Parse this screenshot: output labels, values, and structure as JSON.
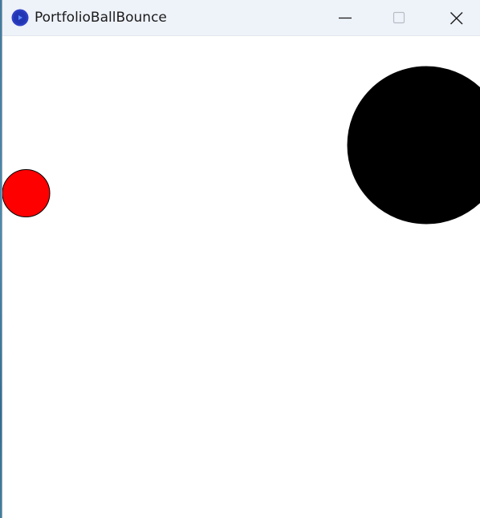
{
  "window": {
    "title": "PortfolioBallBounce",
    "app_icon": "app-play-icon",
    "controls": {
      "minimize_icon": "minimize-icon",
      "maximize_icon": "maximize-icon",
      "close_icon": "close-icon"
    }
  },
  "canvas": {
    "background": "#ffffff",
    "balls": [
      {
        "name": "red-ball",
        "fill": "#ff0000",
        "stroke": "#000000"
      },
      {
        "name": "black-ball",
        "fill": "#000000",
        "stroke": "#000000"
      }
    ]
  },
  "colors": {
    "titlebar": "#eef2f9",
    "icon_blue": "#2d3fc4"
  }
}
